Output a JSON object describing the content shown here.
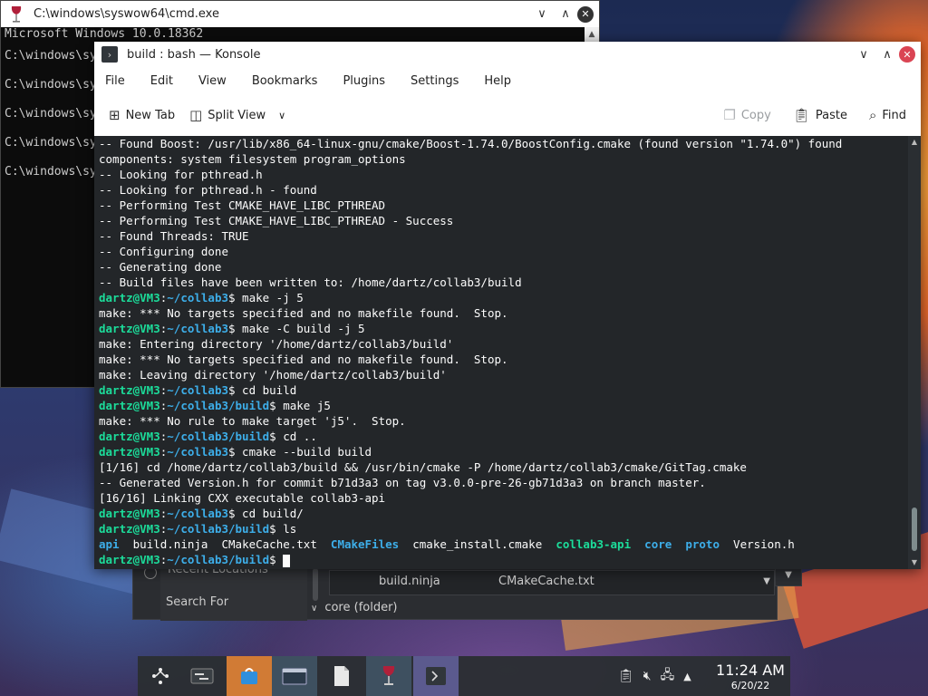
{
  "cmd": {
    "title": "C:\\windows\\syswow64\\cmd.exe",
    "header_line": "Microsoft Windows 10.0.18362",
    "prompt_lines": [
      "C:\\windows\\sy",
      "C:\\windows\\sy",
      "C:\\windows\\sy",
      "C:\\windows\\sy",
      "C:\\windows\\sy"
    ],
    "controls": {
      "minimize": "∨",
      "maximize": "∧",
      "close": "✕"
    }
  },
  "konsole": {
    "title": "build : bash — Konsole",
    "menu": [
      "File",
      "Edit",
      "View",
      "Bookmarks",
      "Plugins",
      "Settings",
      "Help"
    ],
    "toolbar": {
      "new_tab": "New Tab",
      "split_view": "Split View",
      "copy": "Copy",
      "paste": "Paste",
      "find": "Find"
    },
    "terminal": {
      "lines": [
        "-- Found Boost: /usr/lib/x86_64-linux-gnu/cmake/Boost-1.74.0/BoostConfig.cmake (found version \"1.74.0\") found",
        "components: system filesystem program_options",
        "-- Looking for pthread.h",
        "-- Looking for pthread.h - found",
        "-- Performing Test CMAKE_HAVE_LIBC_PTHREAD",
        "-- Performing Test CMAKE_HAVE_LIBC_PTHREAD - Success",
        "-- Found Threads: TRUE",
        "-- Configuring done",
        "-- Generating done",
        "-- Build files have been written to: /home/dartz/collab3/build"
      ],
      "prompt_user": "dartz@VM3",
      "path_collab3": "~/collab3",
      "path_build": "~/collab3/build",
      "cmd1": " make -j 5",
      "out1": "make: *** No targets specified and no makefile found.  Stop.",
      "cmd2": " make -C build -j 5",
      "out2a": "make: Entering directory '/home/dartz/collab3/build'",
      "out2b": "make: *** No targets specified and no makefile found.  Stop.",
      "out2c": "make: Leaving directory '/home/dartz/collab3/build'",
      "cmd3": " cd build",
      "cmd4": " make j5",
      "out4": "make: *** No rule to make target 'j5'.  Stop.",
      "cmd5": " cd ..",
      "cmd6": " cmake --build build",
      "out6a": "[1/16] cd /home/dartz/collab3/build && /usr/bin/cmake -P /home/dartz/collab3/cmake/GitTag.cmake",
      "out6b": "-- Generated Version.h for commit b71d3a3 on tag v3.0.0-pre-26-gb71d3a3 on branch master.",
      "out6c": "[16/16] Linking CXX executable collab3-api",
      "cmd7": " cd build/",
      "cmd8": " ls",
      "ls": {
        "api": "api",
        "build_ninja": "build.ninja",
        "cmakecache": "CMakeCache.txt",
        "cmakefiles": "CMakeFiles",
        "cmake_install": "cmake_install.cmake",
        "collab3_api": "collab3-api",
        "core": "core",
        "proto": "proto",
        "version_h": "Version.h"
      },
      "dollar": "$",
      "colon": ":"
    }
  },
  "file_dialog": {
    "recent_locations": "Recent Locations",
    "search_for": "Search For",
    "file1": "build.ninja",
    "file2": "CMakeCache.txt",
    "folder_label": "core (folder)"
  },
  "taskbar": {
    "time": "11:24 AM",
    "date": "6/20/22"
  },
  "colors": {
    "prompt_user": "#1cdc9a",
    "prompt_path": "#3daee9",
    "close_button": "#da4453"
  }
}
